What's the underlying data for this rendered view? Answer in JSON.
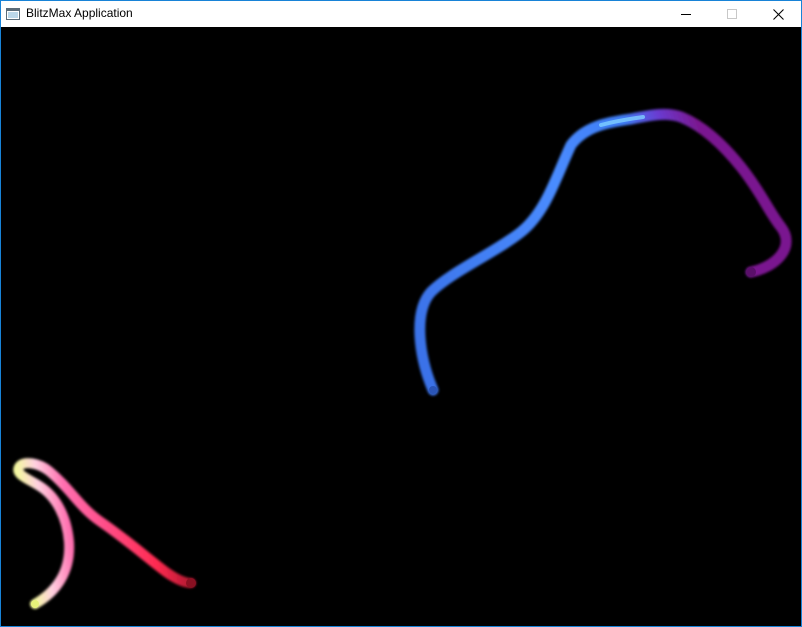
{
  "window": {
    "title": "BlitzMax Application",
    "accent_color": "#1883d7"
  },
  "titlebar": {
    "icon": "app-window-icon",
    "buttons": [
      {
        "name": "minimize",
        "icon": "minimize-icon"
      },
      {
        "name": "maximize",
        "icon": "maximize-icon"
      },
      {
        "name": "close",
        "icon": "close-icon"
      }
    ]
  },
  "canvas": {
    "background": "#000000",
    "trails": [
      {
        "name": "blue-trail",
        "colors": [
          "#3f7df5",
          "#8a1d9e"
        ]
      },
      {
        "name": "pink-trail",
        "colors": [
          "#f7f7a6",
          "#ff5aa0",
          "#ff2a55"
        ]
      }
    ]
  }
}
